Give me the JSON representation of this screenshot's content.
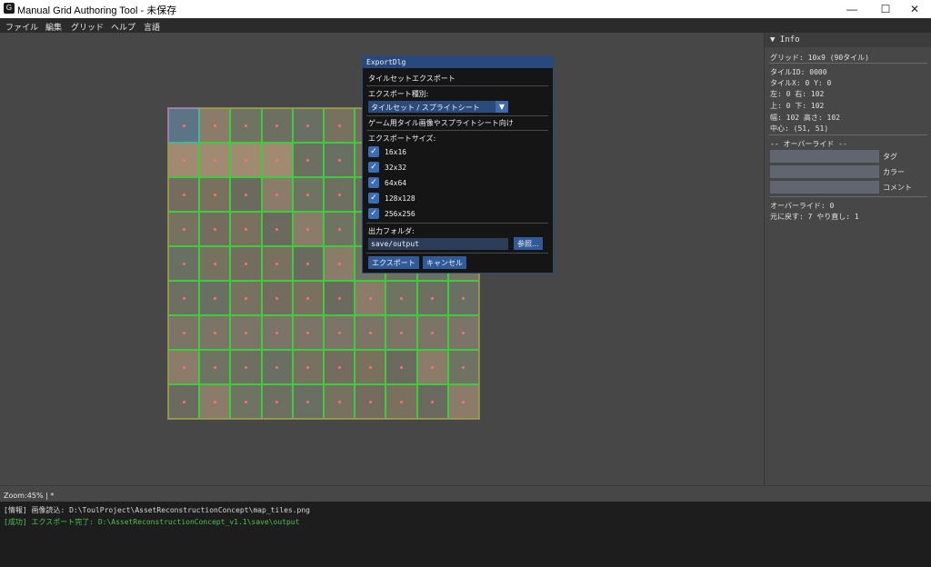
{
  "window": {
    "title": "Manual Grid Authoring Tool - 未保存",
    "app_icon_glyph": "G",
    "minimize_glyph": "—",
    "maximize_glyph": "☐",
    "close_glyph": "✕"
  },
  "menu": [
    "ファイル",
    "編集",
    "グリッド",
    "ヘルプ",
    "言語"
  ],
  "grid": {
    "columns": 10,
    "rows": 9,
    "selected_tile": 0,
    "colors": {
      "outer_border": "#e55a5a",
      "tile_border": "#3ecb3e",
      "selected_border": "#4aa3e8",
      "center_marker": "#ff6f6f"
    }
  },
  "info_panel": {
    "header": "▼  Info",
    "grid_line": "グリッド: 10x9 (90タイル)",
    "tile_id": "タイルID: 0000",
    "tile_xy": "タイルX: 0  Y: 0",
    "left_right": "左: 0  右: 102",
    "top_bottom": "上: 0  下: 102",
    "size": "幅: 102  高さ: 102",
    "center": "中心: (51, 51)",
    "override_header": "-- オーバーライド --",
    "override_fields": [
      {
        "label": "タグ",
        "value": ""
      },
      {
        "label": "カラー",
        "value": ""
      },
      {
        "label": "コメント",
        "value": ""
      }
    ],
    "override_count": "オーバーライド: 0",
    "undo_redo": "元に戻す: 7  やり直し: 1"
  },
  "dialog": {
    "title": "ExportDlg",
    "heading": "タイルセットエクスポート",
    "type_label": "エクスポート種別:",
    "type_value": "タイルセット / スプライトシート",
    "type_arrow": "▼",
    "description": "ゲーム用タイル画像やスプライトシート向け",
    "sizes_label": "エクスポートサイズ:",
    "sizes": [
      {
        "label": "16x16",
        "checked": true
      },
      {
        "label": "32x32",
        "checked": true
      },
      {
        "label": "64x64",
        "checked": true
      },
      {
        "label": "128x128",
        "checked": true
      },
      {
        "label": "256x256",
        "checked": true
      }
    ],
    "check_glyph": "✓",
    "folder_label": "出力フォルダ:",
    "folder_value": "save/output",
    "browse_label": "参照...",
    "export_label": "エクスポート",
    "cancel_label": "キャンセル"
  },
  "status": {
    "zoom": "Zoom:45%  |  *"
  },
  "log": [
    {
      "text": "[情報] 画像読込: D:\\ToulProject\\AssetReconstructionConcept\\map_tiles.png",
      "color": "#d8d8d8"
    },
    {
      "text": "[成功] エクスポート完了: D:\\AssetReconstructionConcept_v1.1\\save\\output",
      "color": "#4cc24c"
    }
  ]
}
